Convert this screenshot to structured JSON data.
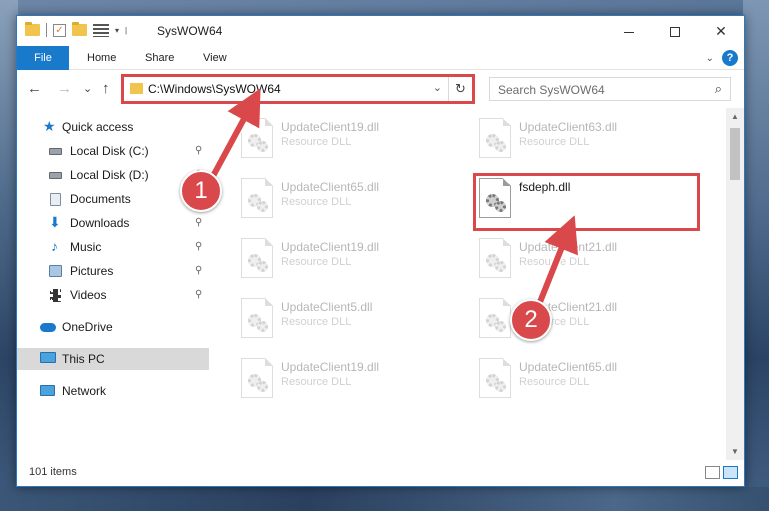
{
  "window": {
    "title": "SysWOW64",
    "controls": {
      "minimize": "",
      "maximize": "",
      "close": "✕"
    }
  },
  "quick_access_toolbar": {
    "caret": "▾",
    "separator": "|"
  },
  "ribbon": {
    "tabs": [
      "File",
      "Home",
      "Share",
      "View"
    ],
    "collapse_chevron": "⌄",
    "help": "?"
  },
  "navigation": {
    "back": "←",
    "forward": "→",
    "recent": "⌄",
    "up": "↑",
    "address": "C:\\Windows\\SysWOW64",
    "address_dropdown": "⌄",
    "refresh": "↻",
    "search_placeholder": "Search SysWOW64",
    "search_icon": "⌕"
  },
  "nav_pane": {
    "items": [
      {
        "label": "Quick access",
        "icon": "star-icon",
        "pinned": false
      },
      {
        "label": "Local Disk (C:)",
        "icon": "drive-icon",
        "pinned": true
      },
      {
        "label": "Local Disk (D:)",
        "icon": "drive-icon",
        "pinned": true
      },
      {
        "label": "Documents",
        "icon": "documents-icon",
        "pinned": true
      },
      {
        "label": "Downloads",
        "icon": "download-icon",
        "pinned": true
      },
      {
        "label": "Music",
        "icon": "music-icon",
        "pinned": true
      },
      {
        "label": "Pictures",
        "icon": "pictures-icon",
        "pinned": true
      },
      {
        "label": "Videos",
        "icon": "videos-icon",
        "pinned": true
      },
      {
        "label": "OneDrive",
        "icon": "cloud-icon",
        "pinned": false
      },
      {
        "label": "This PC",
        "icon": "computer-icon",
        "pinned": false,
        "selected": true
      },
      {
        "label": "Network",
        "icon": "network-icon",
        "pinned": false
      }
    ],
    "pin_glyph": "📌"
  },
  "files": [
    {
      "name": "UpdateClient19.dll",
      "type": "Resource DLL",
      "highlighted": false
    },
    {
      "name": "UpdateClient63.dll",
      "type": "Resource DLL",
      "highlighted": false
    },
    {
      "name": "UpdateClient65.dll",
      "type": "Resource DLL",
      "highlighted": false
    },
    {
      "name": "fsdeph.dll",
      "type": "",
      "highlighted": true
    },
    {
      "name": "UpdateClient19.dll",
      "type": "Resource DLL",
      "highlighted": false
    },
    {
      "name": "UpdateClient21.dll",
      "type": "Resource DLL",
      "highlighted": false
    },
    {
      "name": "UpdateClient5.dll",
      "type": "Resource DLL",
      "highlighted": false
    },
    {
      "name": "UpdateClient21.dll",
      "type": "Resource DLL",
      "highlighted": false
    },
    {
      "name": "UpdateClient19.dll",
      "type": "Resource DLL",
      "highlighted": false
    },
    {
      "name": "UpdateClient65.dll",
      "type": "Resource DLL",
      "highlighted": false
    }
  ],
  "status": {
    "item_count": "101 items"
  },
  "scrollbar": {
    "up": "▲",
    "down": "▼"
  },
  "annotations": [
    {
      "number": "1"
    },
    {
      "number": "2"
    }
  ],
  "colors": {
    "accent": "#1979ca",
    "highlight_red": "#d9484a",
    "selected_bg": "#d9d9d9"
  }
}
